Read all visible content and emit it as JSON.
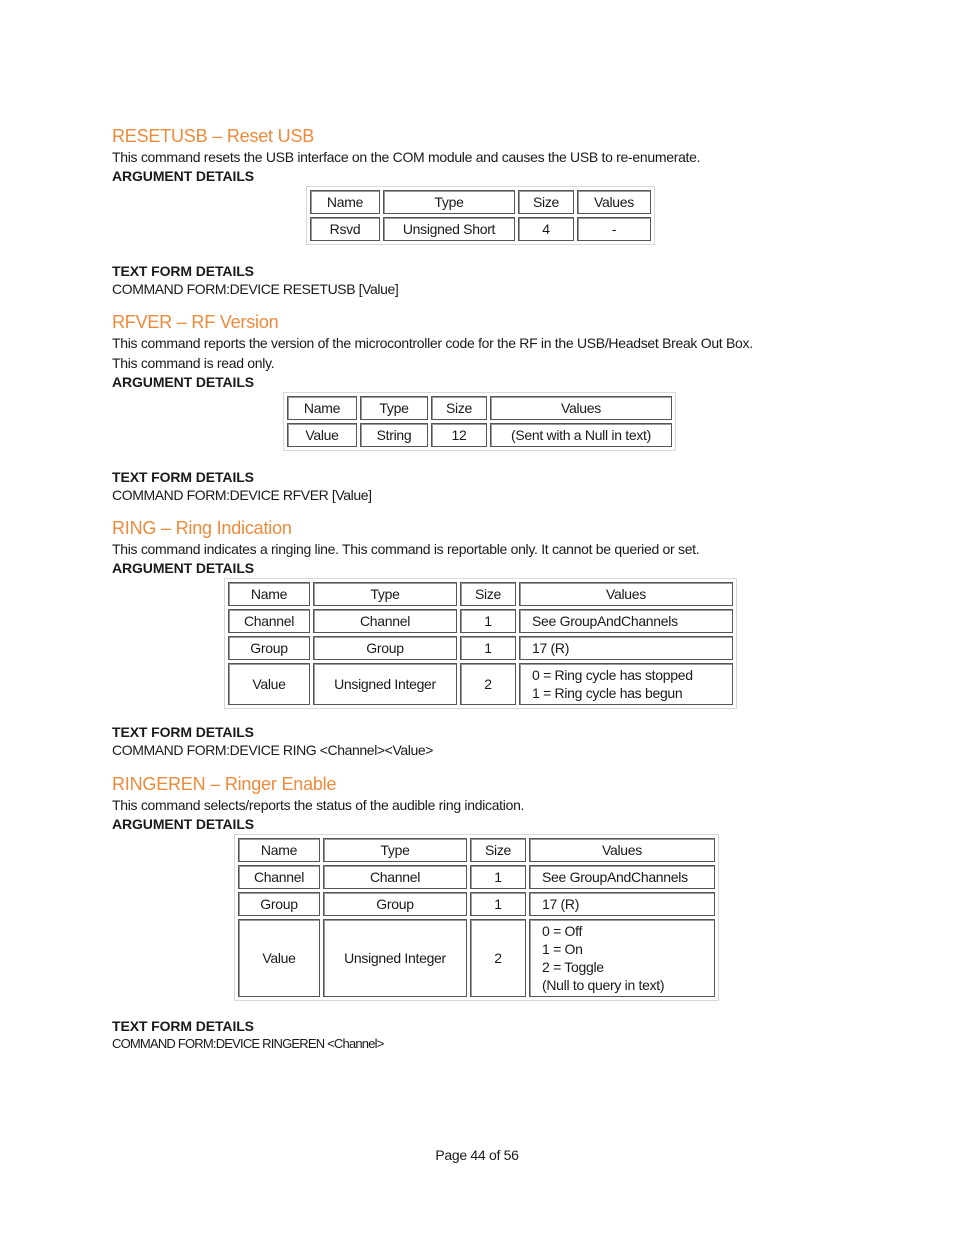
{
  "sections": [
    {
      "heading": "RESETUSB – Reset USB",
      "description": "This command resets the USB interface on the COM module and causes the USB to re-enumerate.",
      "arg_label": "ARGUMENT DETAILS",
      "table": {
        "headers": [
          "Name",
          "Type",
          "Size",
          "Values"
        ],
        "rows": [
          [
            "Rsvd",
            "Unsigned Short",
            "4",
            "-"
          ]
        ]
      },
      "text_form_label": "TEXT FORM DETAILS",
      "command_form": "COMMAND FORM:DEVICE RESETUSB [Value]"
    },
    {
      "heading": "RFVER – RF Version",
      "description": "This command reports the version of the microcontroller code for the RF in the USB/Headset Break Out Box.",
      "description2": "This command is read only.",
      "arg_label": "ARGUMENT DETAILS",
      "table": {
        "headers": [
          "Name",
          "Type",
          "Size",
          "Values"
        ],
        "rows": [
          [
            "Value",
            "String",
            "12",
            "(Sent with a Null in text)"
          ]
        ]
      },
      "text_form_label": "TEXT FORM DETAILS",
      "command_form": "COMMAND FORM:DEVICE RFVER [Value]"
    },
    {
      "heading": "RING – Ring Indication",
      "description": "This command indicates a ringing line. This command is reportable only.  It cannot be queried or set.",
      "arg_label": "ARGUMENT DETAILS",
      "table": {
        "headers": [
          "Name",
          "Type",
          "Size",
          "Values"
        ],
        "rows": [
          [
            "Channel",
            "Channel",
            "1",
            "See GroupAndChannels"
          ],
          [
            "Group",
            "Group",
            "1",
            "17 (R)"
          ],
          [
            "Value",
            "Unsigned Integer",
            "2",
            "0 = Ring cycle has stopped\n1 = Ring cycle has begun"
          ]
        ]
      },
      "text_form_label": "TEXT FORM DETAILS",
      "command_form": "COMMAND FORM:DEVICE RING <Channel><Value>"
    },
    {
      "heading": "RINGEREN – Ringer Enable",
      "description": "This command selects/reports the status of the audible ring indication.",
      "arg_label": "ARGUMENT DETAILS",
      "table": {
        "headers": [
          "Name",
          "Type",
          "Size",
          "Values"
        ],
        "rows": [
          [
            "Channel",
            "Channel",
            "1",
            "See GroupAndChannels"
          ],
          [
            "Group",
            "Group",
            "1",
            "17 (R)"
          ],
          [
            "Value",
            "Unsigned Integer",
            "2",
            "0 = Off\n1 = On\n2 = Toggle\n(Null to query in text)"
          ]
        ]
      },
      "text_form_label": "TEXT FORM DETAILS",
      "command_form": "COMMAND FORM:DEVICE RINGEREN <Channel>"
    }
  ],
  "footer": {
    "page_label": "Page 44 of 56"
  },
  "colors": {
    "heading": "#f08a3a",
    "text": "#1a1a1a"
  }
}
